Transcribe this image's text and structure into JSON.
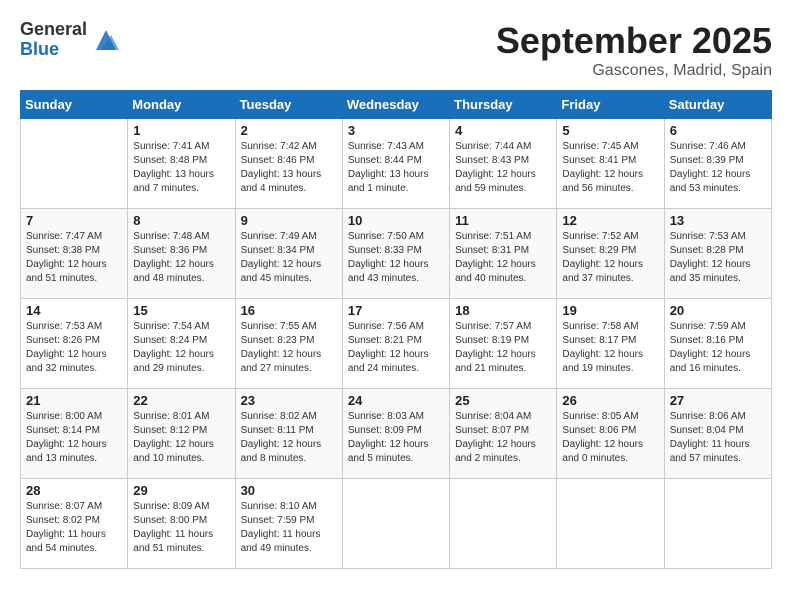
{
  "logo": {
    "general": "General",
    "blue": "Blue"
  },
  "title": "September 2025",
  "location": "Gascones, Madrid, Spain",
  "headers": [
    "Sunday",
    "Monday",
    "Tuesday",
    "Wednesday",
    "Thursday",
    "Friday",
    "Saturday"
  ],
  "weeks": [
    [
      {
        "day": "",
        "info": ""
      },
      {
        "day": "1",
        "info": "Sunrise: 7:41 AM\nSunset: 8:48 PM\nDaylight: 13 hours\nand 7 minutes."
      },
      {
        "day": "2",
        "info": "Sunrise: 7:42 AM\nSunset: 8:46 PM\nDaylight: 13 hours\nand 4 minutes."
      },
      {
        "day": "3",
        "info": "Sunrise: 7:43 AM\nSunset: 8:44 PM\nDaylight: 13 hours\nand 1 minute."
      },
      {
        "day": "4",
        "info": "Sunrise: 7:44 AM\nSunset: 8:43 PM\nDaylight: 12 hours\nand 59 minutes."
      },
      {
        "day": "5",
        "info": "Sunrise: 7:45 AM\nSunset: 8:41 PM\nDaylight: 12 hours\nand 56 minutes."
      },
      {
        "day": "6",
        "info": "Sunrise: 7:46 AM\nSunset: 8:39 PM\nDaylight: 12 hours\nand 53 minutes."
      }
    ],
    [
      {
        "day": "7",
        "info": "Sunrise: 7:47 AM\nSunset: 8:38 PM\nDaylight: 12 hours\nand 51 minutes."
      },
      {
        "day": "8",
        "info": "Sunrise: 7:48 AM\nSunset: 8:36 PM\nDaylight: 12 hours\nand 48 minutes."
      },
      {
        "day": "9",
        "info": "Sunrise: 7:49 AM\nSunset: 8:34 PM\nDaylight: 12 hours\nand 45 minutes."
      },
      {
        "day": "10",
        "info": "Sunrise: 7:50 AM\nSunset: 8:33 PM\nDaylight: 12 hours\nand 43 minutes."
      },
      {
        "day": "11",
        "info": "Sunrise: 7:51 AM\nSunset: 8:31 PM\nDaylight: 12 hours\nand 40 minutes."
      },
      {
        "day": "12",
        "info": "Sunrise: 7:52 AM\nSunset: 8:29 PM\nDaylight: 12 hours\nand 37 minutes."
      },
      {
        "day": "13",
        "info": "Sunrise: 7:53 AM\nSunset: 8:28 PM\nDaylight: 12 hours\nand 35 minutes."
      }
    ],
    [
      {
        "day": "14",
        "info": "Sunrise: 7:53 AM\nSunset: 8:26 PM\nDaylight: 12 hours\nand 32 minutes."
      },
      {
        "day": "15",
        "info": "Sunrise: 7:54 AM\nSunset: 8:24 PM\nDaylight: 12 hours\nand 29 minutes."
      },
      {
        "day": "16",
        "info": "Sunrise: 7:55 AM\nSunset: 8:23 PM\nDaylight: 12 hours\nand 27 minutes."
      },
      {
        "day": "17",
        "info": "Sunrise: 7:56 AM\nSunset: 8:21 PM\nDaylight: 12 hours\nand 24 minutes."
      },
      {
        "day": "18",
        "info": "Sunrise: 7:57 AM\nSunset: 8:19 PM\nDaylight: 12 hours\nand 21 minutes."
      },
      {
        "day": "19",
        "info": "Sunrise: 7:58 AM\nSunset: 8:17 PM\nDaylight: 12 hours\nand 19 minutes."
      },
      {
        "day": "20",
        "info": "Sunrise: 7:59 AM\nSunset: 8:16 PM\nDaylight: 12 hours\nand 16 minutes."
      }
    ],
    [
      {
        "day": "21",
        "info": "Sunrise: 8:00 AM\nSunset: 8:14 PM\nDaylight: 12 hours\nand 13 minutes."
      },
      {
        "day": "22",
        "info": "Sunrise: 8:01 AM\nSunset: 8:12 PM\nDaylight: 12 hours\nand 10 minutes."
      },
      {
        "day": "23",
        "info": "Sunrise: 8:02 AM\nSunset: 8:11 PM\nDaylight: 12 hours\nand 8 minutes."
      },
      {
        "day": "24",
        "info": "Sunrise: 8:03 AM\nSunset: 8:09 PM\nDaylight: 12 hours\nand 5 minutes."
      },
      {
        "day": "25",
        "info": "Sunrise: 8:04 AM\nSunset: 8:07 PM\nDaylight: 12 hours\nand 2 minutes."
      },
      {
        "day": "26",
        "info": "Sunrise: 8:05 AM\nSunset: 8:06 PM\nDaylight: 12 hours\nand 0 minutes."
      },
      {
        "day": "27",
        "info": "Sunrise: 8:06 AM\nSunset: 8:04 PM\nDaylight: 11 hours\nand 57 minutes."
      }
    ],
    [
      {
        "day": "28",
        "info": "Sunrise: 8:07 AM\nSunset: 8:02 PM\nDaylight: 11 hours\nand 54 minutes."
      },
      {
        "day": "29",
        "info": "Sunrise: 8:09 AM\nSunset: 8:00 PM\nDaylight: 11 hours\nand 51 minutes."
      },
      {
        "day": "30",
        "info": "Sunrise: 8:10 AM\nSunset: 7:59 PM\nDaylight: 11 hours\nand 49 minutes."
      },
      {
        "day": "",
        "info": ""
      },
      {
        "day": "",
        "info": ""
      },
      {
        "day": "",
        "info": ""
      },
      {
        "day": "",
        "info": ""
      }
    ]
  ]
}
